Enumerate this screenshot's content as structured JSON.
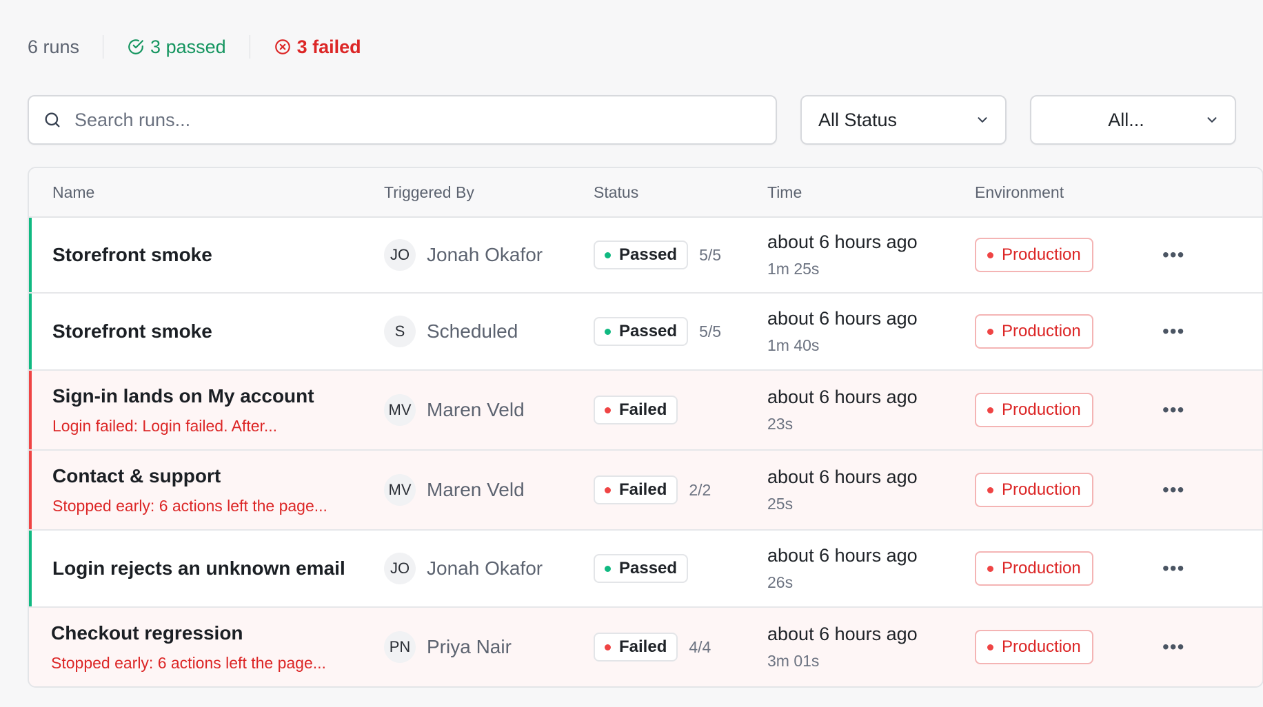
{
  "summary": {
    "total": "6 runs",
    "passed": "3 passed",
    "failed": "3 failed"
  },
  "filters": {
    "search_placeholder": "Search runs...",
    "status_select": "All Status",
    "env_select": "All..."
  },
  "table": {
    "headers": {
      "name": "Name",
      "triggered_by": "Triggered By",
      "status": "Status",
      "time": "Time",
      "environment": "Environment"
    },
    "rows": [
      {
        "name": "Storefront smoke",
        "error": "",
        "initials": "JO",
        "trigger": "Jonah Okafor",
        "status": "Passed",
        "count": "5/5",
        "time": "about 6 hours ago",
        "duration": "1m 25s",
        "env": "Production"
      },
      {
        "name": "Storefront smoke",
        "error": "",
        "initials": "S",
        "trigger": "Scheduled",
        "status": "Passed",
        "count": "5/5",
        "time": "about 6 hours ago",
        "duration": "1m 40s",
        "env": "Production"
      },
      {
        "name": "Sign-in lands on My account",
        "error": "Login failed: Login failed. After...",
        "initials": "MV",
        "trigger": "Maren Veld",
        "status": "Failed",
        "count": "",
        "time": "about 6 hours ago",
        "duration": "23s",
        "env": "Production"
      },
      {
        "name": "Contact & support",
        "error": "Stopped early: 6 actions left the page...",
        "initials": "MV",
        "trigger": "Maren Veld",
        "status": "Failed",
        "count": "2/2",
        "time": "about 6 hours ago",
        "duration": "25s",
        "env": "Production"
      },
      {
        "name": "Login rejects an unknown email",
        "error": "",
        "initials": "JO",
        "trigger": "Jonah Okafor",
        "status": "Passed",
        "count": "",
        "time": "about 6 hours ago",
        "duration": "26s",
        "env": "Production"
      },
      {
        "name": "Checkout regression",
        "error": "Stopped early: 6 actions left the page...",
        "initials": "PN",
        "trigger": "Priya Nair",
        "status": "Failed",
        "count": "4/4",
        "time": "about 6 hours ago",
        "duration": "3m 01s",
        "env": "Production"
      }
    ]
  },
  "more_label": "•••",
  "colors": {
    "passed": "#10b981",
    "failed": "#ef4444",
    "passed_text": "#14955f",
    "failed_text": "#dc2626"
  },
  "icons": {
    "passed": "check-circle-icon",
    "failed": "x-circle-icon",
    "search": "search-icon",
    "chevron": "chevron-down-icon",
    "more": "more-horizontal-icon"
  }
}
